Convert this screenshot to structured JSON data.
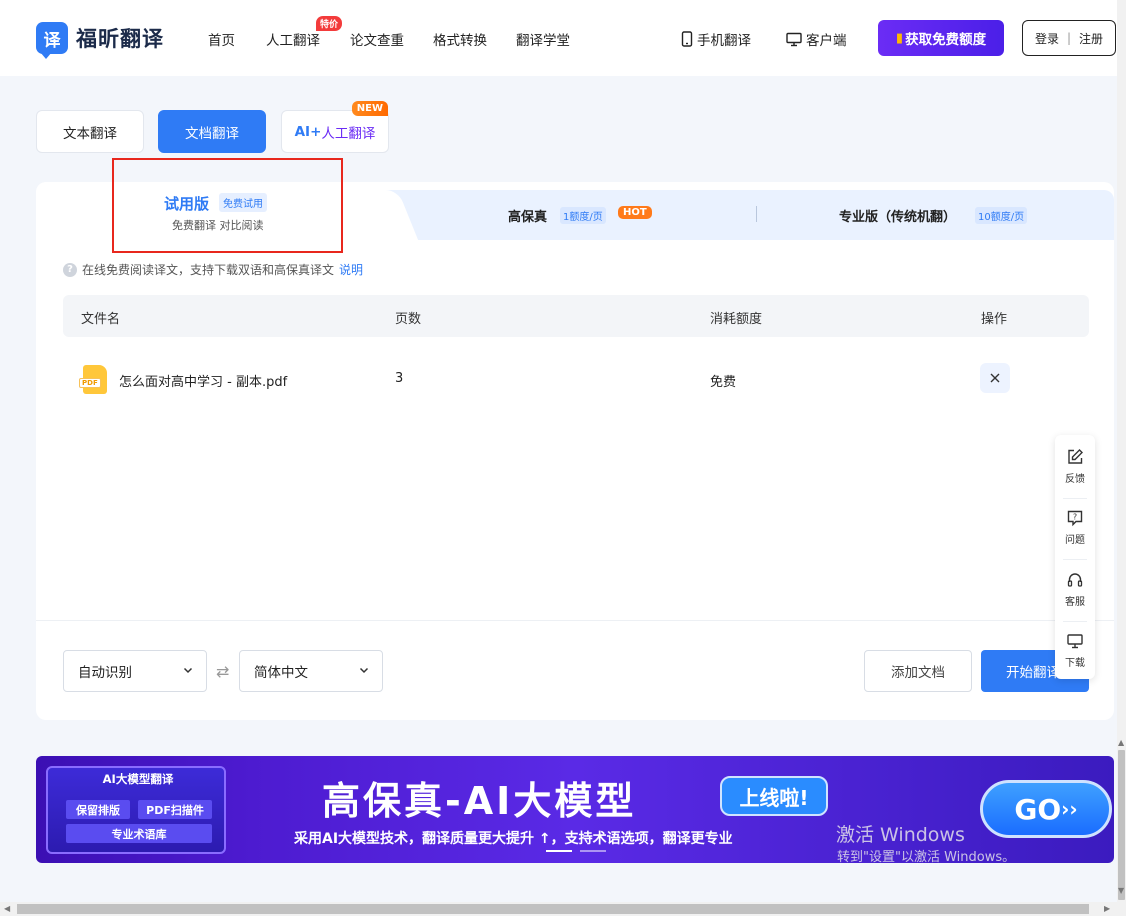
{
  "header": {
    "logo_mark": "译",
    "logo_text": "福昕翻译",
    "nav": [
      {
        "label": "首页"
      },
      {
        "label": "人工翻译",
        "tag": "特价"
      },
      {
        "label": "论文查重"
      },
      {
        "label": "格式转换"
      },
      {
        "label": "翻译学堂"
      }
    ],
    "mobile_label": "手机翻译",
    "client_label": "客户端",
    "free_button": "获取免费额度",
    "login": "登录",
    "login_sep": "|",
    "register": "注册"
  },
  "modes": {
    "text": "文本翻译",
    "doc": "文档翻译",
    "ai_prefix": "AI+",
    "ai_rest": "人工翻译",
    "new_tag": "NEW"
  },
  "tabs": {
    "trial_title": "试用版",
    "trial_badge": "免费试用",
    "trial_sub": "免费翻译 对比阅读",
    "hifi_title": "高保真",
    "hifi_quota": "1额度/页",
    "hifi_tag": "HOT",
    "pro_title": "专业版（传统机翻）",
    "pro_quota": "10额度/页"
  },
  "info": {
    "icon": "?",
    "text": "在线免费阅读译文，支持下载双语和高保真译文",
    "link": "说明"
  },
  "table": {
    "headers": [
      "文件名",
      "页数",
      "消耗额度",
      "操作"
    ],
    "rows": [
      {
        "file": "怎么面对高中学习 - 副本.pdf",
        "pages": "3",
        "cost": "免费",
        "file_icon": "PDF"
      }
    ]
  },
  "controls": {
    "source_lang": "自动识别",
    "target_lang": "简体中文",
    "swap_icon": "⇄",
    "add_doc": "添加文档",
    "start": "开始翻译"
  },
  "side": [
    {
      "label": "反馈",
      "icon": "edit-icon"
    },
    {
      "label": "问题",
      "icon": "question-icon"
    },
    {
      "label": "客服",
      "icon": "headset-icon"
    },
    {
      "label": "下载",
      "icon": "monitor-icon"
    }
  ],
  "banner": {
    "box_title": "AI大模型翻译",
    "chip1": "保留排版",
    "chip2": "PDF扫描件",
    "chip3": "专业术语库",
    "title": "高保真-AI大模型",
    "pill": "上线啦!",
    "subtitle": "采用AI大模型技术，翻译质量更大提升 ↑，支持术语选项，翻译更专业",
    "go": "GO"
  },
  "watermark": {
    "line1": "激活 Windows",
    "line2": "转到\"设置\"以激活 Windows。"
  },
  "colors": {
    "accent": "#2f7bf5",
    "purple": "#6b2cf5",
    "hot": "#ff7a1a",
    "highlight": "#e8271d"
  }
}
